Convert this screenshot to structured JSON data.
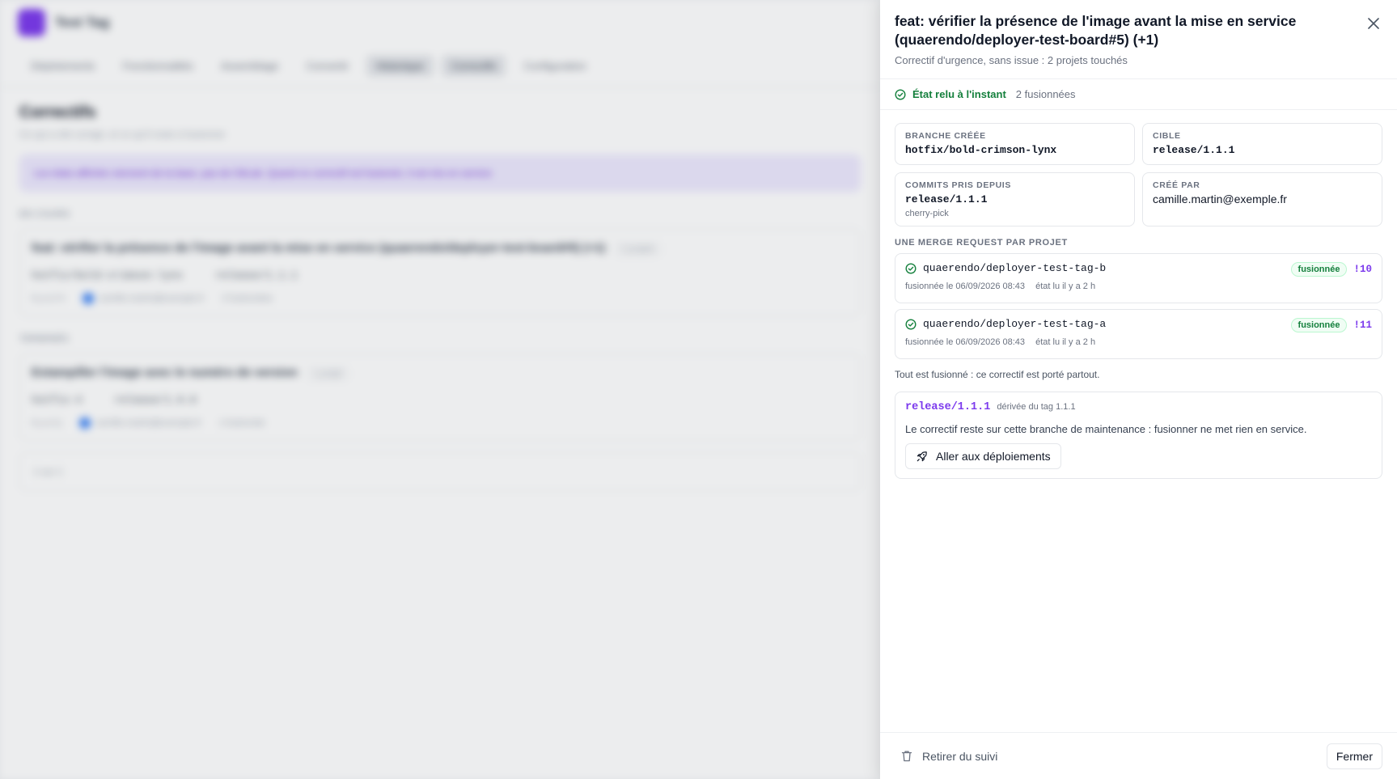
{
  "background": {
    "app_title": "Test Tag",
    "nav": [
      "Déploiements",
      "Fonctionnalités",
      "Assemblage",
      "Convertir",
      "Historique",
      "Correctifs",
      "Configuration"
    ],
    "page_title": "Correctifs",
    "page_subtitle": "Ce qui a été corrigé, et ce qu'il reste à fusionner",
    "banner": "Les états affichés viennent de la base, pas de GitLab. Quand ce correctif est fusionné, il est mis en service",
    "section_active": "EN COURS",
    "active_card": {
      "title": "feat: vérifier la présence de l'image avant la mise en service (quaerendo/deployer-test-board#5) (+1)",
      "chip": "2 projets",
      "branch": "hotfix/bold-crimson-lynx",
      "target": "release/1.1.1",
      "meta_a": "il y a 2 h",
      "meta_b": "camille.martin@exemple.fr",
      "meta_c": "2 fusionnées"
    },
    "section_done": "TERMINÉS",
    "done_card": {
      "title": "Estampiller l'image avec le numéro de version",
      "chip": "1 projet",
      "branch": "hotfix-4",
      "target": "release/1.0.0",
      "meta_a": "il y a 3 j",
      "meta_b": "camille.martin@exemple.fr",
      "meta_c": "1 fusionnée"
    },
    "footer_empty": "1 sur 1"
  },
  "drawer": {
    "title": "feat: vérifier la présence de l'image avant la mise en service (quaerendo/deployer-test-board#5) (+1)",
    "subtitle": "Correctif d'urgence, sans issue : 2 projets touchés",
    "status_text": "État relu à l'instant",
    "status_count": "2 fusionnées",
    "created_branch": {
      "label": "BRANCHE CRÉÉE",
      "value": "hotfix/bold-crimson-lynx"
    },
    "target": {
      "label": "CIBLE",
      "value": "release/1.1.1"
    },
    "commits_from": {
      "label": "COMMITS PRIS DEPUIS",
      "value": "release/1.1.1",
      "hint": "cherry-pick"
    },
    "created_by": {
      "label": "CRÉÉ PAR",
      "value": "camille.martin@exemple.fr"
    },
    "mr_section_label": "UNE MERGE REQUEST PAR PROJET",
    "merge_requests": [
      {
        "project": "quaerendo/deployer-test-tag-b",
        "status": "fusionnée",
        "id": "!10",
        "merged_at": "fusionnée le 06/09/2026 08:43",
        "read_at": "état lu il y a 2 h"
      },
      {
        "project": "quaerendo/deployer-test-tag-a",
        "status": "fusionnée",
        "id": "!11",
        "merged_at": "fusionnée le 06/09/2026 08:43",
        "read_at": "état lu il y a 2 h"
      }
    ],
    "all_merged": "Tout est fusionné : ce correctif est porté partout.",
    "release": {
      "branch": "release/1.1.1",
      "derived": "dérivée du tag 1.1.1",
      "description": "Le correctif reste sur cette branche de maintenance : fusionner ne met rien en service.",
      "deploy_button": "Aller aux déploiements"
    },
    "footer": {
      "untrack": "Retirer du suivi",
      "close": "Fermer"
    }
  },
  "colors": {
    "accent": "#7c3aed",
    "success": "#15803d"
  },
  "icons": {
    "close": "close-icon",
    "status": "check-circle-icon",
    "deploy": "rocket-icon",
    "untrack": "trash-icon"
  }
}
